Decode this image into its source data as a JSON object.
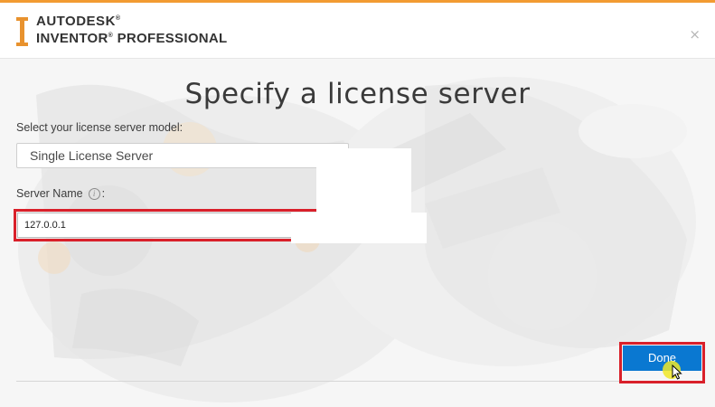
{
  "header": {
    "brand_line1": "AUTODESK",
    "brand_line1_mark": "®",
    "brand_line2": "INVENTOR",
    "brand_line2_mark": "®",
    "brand_line2_suffix": " PROFESSIONAL",
    "close_glyph": "×"
  },
  "dialog": {
    "title": "Specify a license server",
    "model_label": "Select your license server model:",
    "model_value": "Single License Server",
    "server_name_label": "Server Name",
    "info_glyph": "i",
    "server_name_suffix": ":",
    "server_name_value": "127.0.0.1",
    "done_label": "Done"
  },
  "colors": {
    "accent_orange": "#f29b32",
    "primary_blue": "#0a78d1",
    "highlight_red": "#d9202a"
  },
  "icons": {
    "brand": "autodesk-i-beam-icon",
    "close": "close-icon",
    "info": "info-icon",
    "cursor": "mouse-pointer-icon"
  }
}
